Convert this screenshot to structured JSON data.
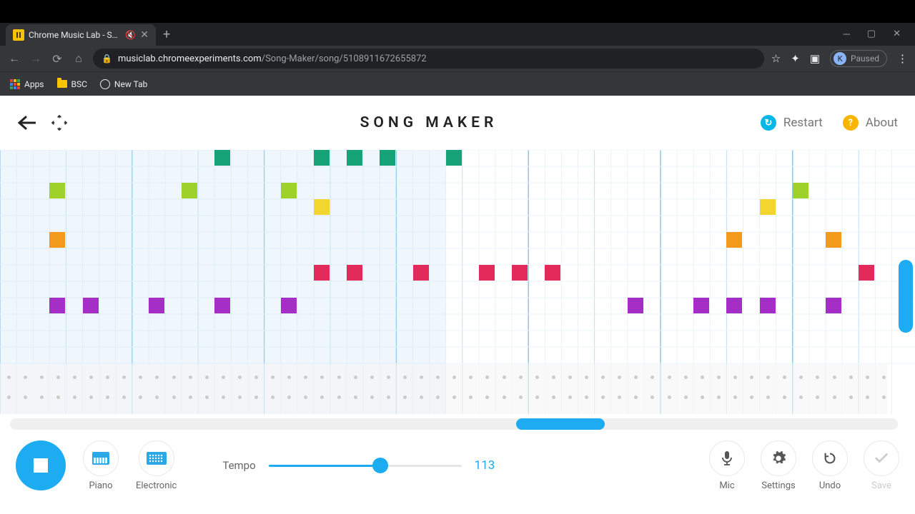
{
  "browser": {
    "tab_title": "Chrome Music Lab - Song M",
    "url_host": "musiclab.chromeexperiments.com",
    "url_path": "/Song-Maker/song/5108911672655872",
    "profile_letter": "K",
    "profile_state": "Paused",
    "bookmarks": {
      "apps": "Apps",
      "bsc": "BSC",
      "newtab": "New Tab"
    }
  },
  "header": {
    "title": "SONG MAKER",
    "restart": "Restart",
    "about": "About"
  },
  "grid": {
    "cols": 54,
    "rows": 13,
    "col_w": 23.1,
    "row_h": 23.0,
    "playing_bar": 27,
    "barlines_every": 4,
    "major_every": 8,
    "colors": {
      "teal": "#17a378",
      "lime": "#9fd12b",
      "yellow": "#f3d530",
      "orange": "#f39a1d",
      "magenta": "#e22a5b",
      "purple": "#a52fc6"
    },
    "notes": [
      {
        "c": 13,
        "r": 0,
        "color": "teal"
      },
      {
        "c": 19,
        "r": 0,
        "color": "teal"
      },
      {
        "c": 21,
        "r": 0,
        "color": "teal"
      },
      {
        "c": 23,
        "r": 0,
        "color": "teal"
      },
      {
        "c": 27,
        "r": 0,
        "color": "teal"
      },
      {
        "c": 3,
        "r": 2,
        "color": "lime"
      },
      {
        "c": 11,
        "r": 2,
        "color": "lime"
      },
      {
        "c": 17,
        "r": 2,
        "color": "lime"
      },
      {
        "c": 48,
        "r": 2,
        "color": "lime"
      },
      {
        "c": 19,
        "r": 3,
        "color": "yellow"
      },
      {
        "c": 46,
        "r": 3,
        "color": "yellow"
      },
      {
        "c": 3,
        "r": 5,
        "color": "orange"
      },
      {
        "c": 44,
        "r": 5,
        "color": "orange"
      },
      {
        "c": 50,
        "r": 5,
        "color": "orange"
      },
      {
        "c": 19,
        "r": 7,
        "color": "magenta"
      },
      {
        "c": 21,
        "r": 7,
        "color": "magenta"
      },
      {
        "c": 25,
        "r": 7,
        "color": "magenta"
      },
      {
        "c": 29,
        "r": 7,
        "color": "magenta"
      },
      {
        "c": 31,
        "r": 7,
        "color": "magenta"
      },
      {
        "c": 33,
        "r": 7,
        "color": "magenta"
      },
      {
        "c": 52,
        "r": 7,
        "color": "magenta"
      },
      {
        "c": 3,
        "r": 9,
        "color": "purple"
      },
      {
        "c": 5,
        "r": 9,
        "color": "purple"
      },
      {
        "c": 9,
        "r": 9,
        "color": "purple"
      },
      {
        "c": 13,
        "r": 9,
        "color": "purple"
      },
      {
        "c": 17,
        "r": 9,
        "color": "purple"
      },
      {
        "c": 38,
        "r": 9,
        "color": "purple"
      },
      {
        "c": 42,
        "r": 9,
        "color": "purple"
      },
      {
        "c": 44,
        "r": 9,
        "color": "purple"
      },
      {
        "c": 46,
        "r": 9,
        "color": "purple"
      },
      {
        "c": 50,
        "r": 9,
        "color": "purple"
      }
    ]
  },
  "hscroll": {
    "left_pct": 57,
    "width_pct": 10
  },
  "vscroll": {
    "top_pct": 20,
    "height_pct": 60
  },
  "controls": {
    "instruments": {
      "melody": "Piano",
      "rhythm": "Electronic"
    },
    "tempo_label": "Tempo",
    "tempo_value": "113",
    "tempo_pct": 58,
    "tools": {
      "mic": "Mic",
      "settings": "Settings",
      "undo": "Undo",
      "save": "Save"
    }
  }
}
